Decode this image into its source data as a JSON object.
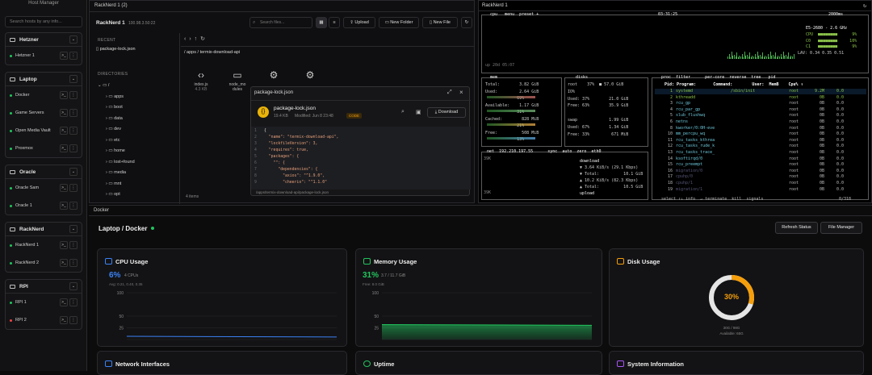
{
  "sidebar": {
    "title": "Host Manager",
    "search_placeholder": "Search hosts by any info...",
    "groups": [
      {
        "name": "Hetzner",
        "hosts": [
          {
            "name": "Hetzner 1",
            "status": "green"
          }
        ]
      },
      {
        "name": "Laptop",
        "hosts": [
          {
            "name": "Docker",
            "status": "green"
          },
          {
            "name": "Game Servers",
            "status": "green"
          },
          {
            "name": "Open Media Vault",
            "status": "green"
          },
          {
            "name": "Proxmox",
            "status": "green"
          }
        ]
      },
      {
        "name": "Oracle",
        "hosts": [
          {
            "name": "Oracle Sam",
            "status": "green"
          },
          {
            "name": "Oracle 1",
            "status": "green"
          }
        ]
      },
      {
        "name": "RackNerd",
        "hosts": [
          {
            "name": "RackNerd 1",
            "status": "green"
          },
          {
            "name": "RackNerd 2",
            "status": "green"
          }
        ]
      },
      {
        "name": "RPI",
        "hosts": [
          {
            "name": "RPI 1",
            "status": "green"
          },
          {
            "name": "RPI 2",
            "status": "red"
          }
        ]
      }
    ]
  },
  "fm": {
    "tab": "RackNerd 1 (2)",
    "host": "RackNerd 1",
    "ip": "100.98.3.50:22",
    "search_placeholder": "Search files...",
    "upload": "Upload",
    "new_folder": "New Folder",
    "new_file": "New File",
    "recent_label": "RECENT",
    "recent_file": "package-lock.json",
    "dirs_label": "DIRECTORIES",
    "tree": [
      "/",
      "apps",
      "boot",
      "data",
      "dev",
      "etc",
      "home",
      "lost+found",
      "media",
      "mnt",
      "opt"
    ],
    "path": "/ apps / termix-download-api",
    "files": [
      {
        "name": "index.js",
        "meta": "4.3 KB",
        "icon": "code-icon"
      },
      {
        "name": "node_mo dules",
        "meta": "",
        "icon": "folder-icon"
      },
      {
        "name": "",
        "meta": "",
        "icon": "gear-icon"
      },
      {
        "name": "",
        "meta": "",
        "icon": "gear-icon"
      }
    ],
    "items_count": "4 items"
  },
  "preview": {
    "title": "package-lock.json",
    "file": "package-lock.json",
    "size": "19.4 KB",
    "modified": "Modified: Jun 8 23:48",
    "badge": "CODE",
    "download": "Download",
    "footer_path": "/apps/termix-download-api/package-lock.json",
    "code": [
      "{",
      "  \"name\": \"termix-download-api\",",
      "  \"lockfileVersion\": 3,",
      "  \"requires\": true,",
      "  \"packages\": {",
      "    \"\": {",
      "      \"dependencies\": {",
      "        \"axios\": \"^1.9.0\",",
      "        \"cheerio\": \"^1.1.0\""
    ]
  },
  "term": {
    "tab": "RackNerd 1",
    "cpu_hdr": "cpu   menu  preset +",
    "clock": "03:31:25",
    "interval": "2000ms",
    "cpu_model": "E5-2680 - 2.6 GHz",
    "cpu_lines": [
      "CPU  ■■■■■■■■      9%",
      "C0   ■■■■■■■■     10%",
      "C1   ■■■■■■■■      9%"
    ],
    "lav": "LAV: 0.34 0.35 0.51",
    "uptime": "up 20d 05:07",
    "mem": [
      "Total:        3.82 GiB",
      "Used:         2.64 GiB",
      "             69%",
      "Available:    1.17 GiB",
      "             31%",
      "Cached:        828 MiB",
      "             21%",
      "Free:          508 MiB",
      "             13%"
    ],
    "disks": [
      "root    37%  ■ 57.0 GiB",
      "IO%",
      "Used: 37%        21.0 GiB",
      "Free: 63%        35.9 GiB",
      "",
      "swap             1.99 GiB",
      "Used: 67%        1.34 GiB",
      "Free: 33%         671 MiB"
    ],
    "net_hdr": "net  192.210.197.55      sync  auto  zero  eth0",
    "net": [
      "download",
      "▼ 3.64 KiB/s (29.1 Kbps)",
      "▼ Total:          10.1 GiB",
      "▲ 10.2 KiB/s (82.3 Kbps)",
      "▲ Total:          10.5 GiB",
      "upload"
    ],
    "net_scale": [
      "39K",
      "39K"
    ],
    "proc_hdr": "proc  filter      per-core  reverse  tree   pid",
    "proc_cols": "Pid: Program:       Command:        User:  MemB    Cpu% ↑",
    "procs": [
      [
        "1",
        "systemd",
        "/sbin/init",
        "root",
        "9.2M",
        "0.0"
      ],
      [
        "2",
        "kthreadd",
        "",
        "root",
        "0B",
        "0.0"
      ],
      [
        "3",
        "rcu_gp",
        "",
        "root",
        "0B",
        "0.0"
      ],
      [
        "4",
        "rcu_par_gp",
        "",
        "root",
        "0B",
        "0.0"
      ],
      [
        "5",
        "slub_flushwq",
        "",
        "root",
        "0B",
        "0.0"
      ],
      [
        "6",
        "netns",
        "",
        "root",
        "0B",
        "0.0"
      ],
      [
        "8",
        "kworker/0:0H-eve",
        "",
        "root",
        "0B",
        "0.0"
      ],
      [
        "10",
        "mm_percpu_wq",
        "",
        "root",
        "0B",
        "0.0"
      ],
      [
        "11",
        "rcu_tasks_kthrea",
        "",
        "root",
        "0B",
        "0.0"
      ],
      [
        "12",
        "rcu_tasks_rude_k",
        "",
        "root",
        "0B",
        "0.0"
      ],
      [
        "13",
        "rcu_tasks_trace_",
        "",
        "root",
        "0B",
        "0.0"
      ],
      [
        "14",
        "ksoftirqd/0",
        "",
        "root",
        "0B",
        "0.0"
      ],
      [
        "15",
        "rcu_preempt",
        "",
        "root",
        "0B",
        "0.0"
      ],
      [
        "16",
        "migration/0",
        "",
        "root",
        "0B",
        "0.0"
      ],
      [
        "17",
        "cpuhp/0",
        "",
        "root",
        "0B",
        "0.0"
      ],
      [
        "18",
        "cpuhp/1",
        "",
        "root",
        "0B",
        "0.0"
      ],
      [
        "19",
        "migration/1",
        "",
        "root",
        "0B",
        "0.0"
      ]
    ],
    "proc_footer": "select ↑↓ info  ↵ terminate  kill  signals",
    "proc_count": "0/318"
  },
  "docker": {
    "tab": "Docker",
    "title": "Laptop / Docker",
    "refresh": "Refresh Status",
    "file_manager": "File Manager",
    "cpu": {
      "title": "CPU Usage",
      "value": "6%",
      "sub": "4 CPUs",
      "avg": "Avg: 0.21, 0.40, 0.35",
      "axis": [
        "100",
        "50",
        "25",
        "0"
      ]
    },
    "memory": {
      "title": "Memory Usage",
      "value": "31%",
      "sub": "3.7 / 11.7 GiB",
      "free": "Free: 8.0 GiB",
      "axis": [
        "100",
        "50",
        "25",
        "0"
      ]
    },
    "disk": {
      "title": "Disk Usage",
      "value": "30%",
      "used": "30G / 98G",
      "available": "Available: 65G",
      "percent": 30
    },
    "network": {
      "title": "Network Interfaces"
    },
    "uptime": {
      "title": "Uptime"
    },
    "sysinfo": {
      "title": "System Information"
    },
    "colors": {
      "accent_blue": "#3b82f6",
      "accent_green": "#22c55e",
      "accent_orange": "#f59e0b",
      "accent_purple": "#a855f7"
    }
  }
}
